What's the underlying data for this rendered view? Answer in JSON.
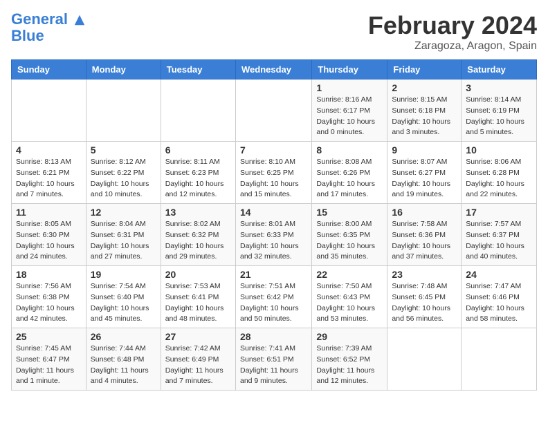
{
  "logo": {
    "line1": "General",
    "line2": "Blue"
  },
  "title": "February 2024",
  "location": "Zaragoza, Aragon, Spain",
  "weekdays": [
    "Sunday",
    "Monday",
    "Tuesday",
    "Wednesday",
    "Thursday",
    "Friday",
    "Saturday"
  ],
  "weeks": [
    [
      {
        "day": "",
        "info": ""
      },
      {
        "day": "",
        "info": ""
      },
      {
        "day": "",
        "info": ""
      },
      {
        "day": "",
        "info": ""
      },
      {
        "day": "1",
        "info": "Sunrise: 8:16 AM\nSunset: 6:17 PM\nDaylight: 10 hours\nand 0 minutes."
      },
      {
        "day": "2",
        "info": "Sunrise: 8:15 AM\nSunset: 6:18 PM\nDaylight: 10 hours\nand 3 minutes."
      },
      {
        "day": "3",
        "info": "Sunrise: 8:14 AM\nSunset: 6:19 PM\nDaylight: 10 hours\nand 5 minutes."
      }
    ],
    [
      {
        "day": "4",
        "info": "Sunrise: 8:13 AM\nSunset: 6:21 PM\nDaylight: 10 hours\nand 7 minutes."
      },
      {
        "day": "5",
        "info": "Sunrise: 8:12 AM\nSunset: 6:22 PM\nDaylight: 10 hours\nand 10 minutes."
      },
      {
        "day": "6",
        "info": "Sunrise: 8:11 AM\nSunset: 6:23 PM\nDaylight: 10 hours\nand 12 minutes."
      },
      {
        "day": "7",
        "info": "Sunrise: 8:10 AM\nSunset: 6:25 PM\nDaylight: 10 hours\nand 15 minutes."
      },
      {
        "day": "8",
        "info": "Sunrise: 8:08 AM\nSunset: 6:26 PM\nDaylight: 10 hours\nand 17 minutes."
      },
      {
        "day": "9",
        "info": "Sunrise: 8:07 AM\nSunset: 6:27 PM\nDaylight: 10 hours\nand 19 minutes."
      },
      {
        "day": "10",
        "info": "Sunrise: 8:06 AM\nSunset: 6:28 PM\nDaylight: 10 hours\nand 22 minutes."
      }
    ],
    [
      {
        "day": "11",
        "info": "Sunrise: 8:05 AM\nSunset: 6:30 PM\nDaylight: 10 hours\nand 24 minutes."
      },
      {
        "day": "12",
        "info": "Sunrise: 8:04 AM\nSunset: 6:31 PM\nDaylight: 10 hours\nand 27 minutes."
      },
      {
        "day": "13",
        "info": "Sunrise: 8:02 AM\nSunset: 6:32 PM\nDaylight: 10 hours\nand 29 minutes."
      },
      {
        "day": "14",
        "info": "Sunrise: 8:01 AM\nSunset: 6:33 PM\nDaylight: 10 hours\nand 32 minutes."
      },
      {
        "day": "15",
        "info": "Sunrise: 8:00 AM\nSunset: 6:35 PM\nDaylight: 10 hours\nand 35 minutes."
      },
      {
        "day": "16",
        "info": "Sunrise: 7:58 AM\nSunset: 6:36 PM\nDaylight: 10 hours\nand 37 minutes."
      },
      {
        "day": "17",
        "info": "Sunrise: 7:57 AM\nSunset: 6:37 PM\nDaylight: 10 hours\nand 40 minutes."
      }
    ],
    [
      {
        "day": "18",
        "info": "Sunrise: 7:56 AM\nSunset: 6:38 PM\nDaylight: 10 hours\nand 42 minutes."
      },
      {
        "day": "19",
        "info": "Sunrise: 7:54 AM\nSunset: 6:40 PM\nDaylight: 10 hours\nand 45 minutes."
      },
      {
        "day": "20",
        "info": "Sunrise: 7:53 AM\nSunset: 6:41 PM\nDaylight: 10 hours\nand 48 minutes."
      },
      {
        "day": "21",
        "info": "Sunrise: 7:51 AM\nSunset: 6:42 PM\nDaylight: 10 hours\nand 50 minutes."
      },
      {
        "day": "22",
        "info": "Sunrise: 7:50 AM\nSunset: 6:43 PM\nDaylight: 10 hours\nand 53 minutes."
      },
      {
        "day": "23",
        "info": "Sunrise: 7:48 AM\nSunset: 6:45 PM\nDaylight: 10 hours\nand 56 minutes."
      },
      {
        "day": "24",
        "info": "Sunrise: 7:47 AM\nSunset: 6:46 PM\nDaylight: 10 hours\nand 58 minutes."
      }
    ],
    [
      {
        "day": "25",
        "info": "Sunrise: 7:45 AM\nSunset: 6:47 PM\nDaylight: 11 hours\nand 1 minute."
      },
      {
        "day": "26",
        "info": "Sunrise: 7:44 AM\nSunset: 6:48 PM\nDaylight: 11 hours\nand 4 minutes."
      },
      {
        "day": "27",
        "info": "Sunrise: 7:42 AM\nSunset: 6:49 PM\nDaylight: 11 hours\nand 7 minutes."
      },
      {
        "day": "28",
        "info": "Sunrise: 7:41 AM\nSunset: 6:51 PM\nDaylight: 11 hours\nand 9 minutes."
      },
      {
        "day": "29",
        "info": "Sunrise: 7:39 AM\nSunset: 6:52 PM\nDaylight: 11 hours\nand 12 minutes."
      },
      {
        "day": "",
        "info": ""
      },
      {
        "day": "",
        "info": ""
      }
    ]
  ]
}
